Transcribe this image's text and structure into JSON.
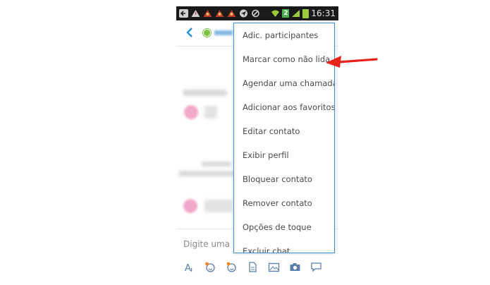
{
  "statusbar": {
    "time": "16:31",
    "notification_count": "2",
    "icons": [
      "download-icon",
      "warning-icon",
      "user-alert-icon",
      "user-alert-icon",
      "user-alert-icon",
      "send-icon",
      "ban-icon",
      "wifi-icon",
      "signal-icon",
      "battery-icon"
    ]
  },
  "composer": {
    "placeholder": "Digite uma me"
  },
  "toolbar": {
    "icons": [
      "font-icon",
      "emoticon-icon",
      "emoticon-sticker-icon",
      "file-icon",
      "photo-icon",
      "camera-icon",
      "chat-icon",
      "more-icon"
    ]
  },
  "menu": {
    "items": [
      {
        "label": "Adic. participantes"
      },
      {
        "label": "Marcar como não lida"
      },
      {
        "label": "Agendar uma chamada"
      },
      {
        "label": "Adicionar aos favoritos"
      },
      {
        "label": "Editar contato"
      },
      {
        "label": "Exibir perfil"
      },
      {
        "label": "Bloquear contato"
      },
      {
        "label": "Remover contato"
      },
      {
        "label": "Opções de toque"
      },
      {
        "label": "Excluir chat"
      }
    ]
  },
  "colors": {
    "accent": "#3f8ed6",
    "arrow": "#e8231b",
    "online": "#7cc142"
  }
}
